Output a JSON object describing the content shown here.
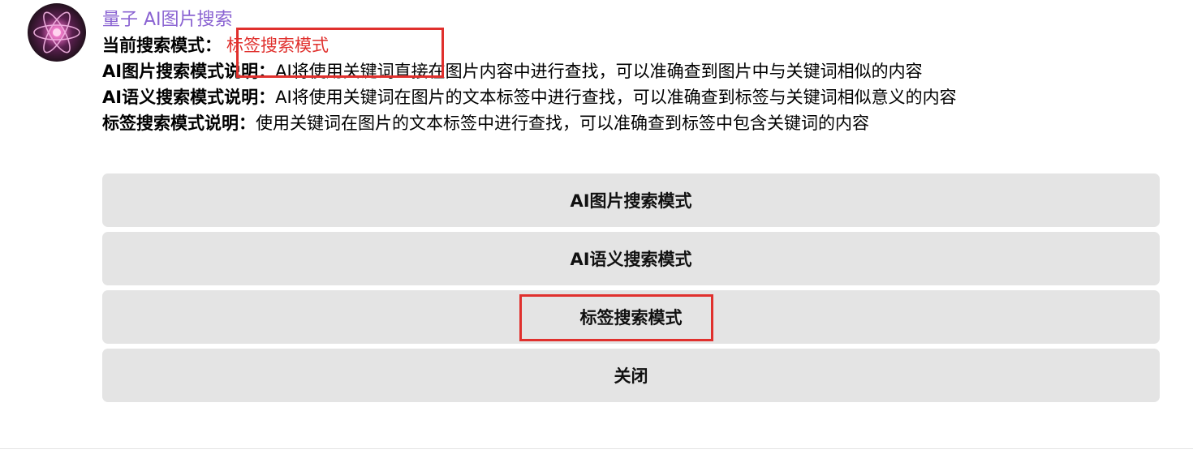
{
  "bot": {
    "name": "量子 AI图片搜索",
    "avatar_icon": "atom-icon"
  },
  "message": {
    "current_mode_label": "当前搜索模式：",
    "current_mode_value": "标签搜索模式",
    "descriptions": [
      {
        "label": "AI图片搜索模式说明：",
        "text": "AI将使用关键词直接在图片内容中进行查找，可以准确查到图片中与关键词相似的内容"
      },
      {
        "label": "AI语义搜索模式说明：",
        "text": "AI将使用关键词在图片的文本标签中进行查找，可以准确查到标签与关键词相似意义的内容"
      },
      {
        "label": "标签搜索模式说明：",
        "text": "使用关键词在图片的文本标签中进行查找，可以准确查到标签中包含关键词的内容"
      }
    ]
  },
  "buttons": [
    {
      "label": "AI图片搜索模式"
    },
    {
      "label": "AI语义搜索模式"
    },
    {
      "label": "标签搜索模式"
    },
    {
      "label": "关闭"
    }
  ],
  "colors": {
    "accent_name": "#8a63d2",
    "highlight": "#e0302d",
    "button_bg": "#e4e4e4"
  }
}
